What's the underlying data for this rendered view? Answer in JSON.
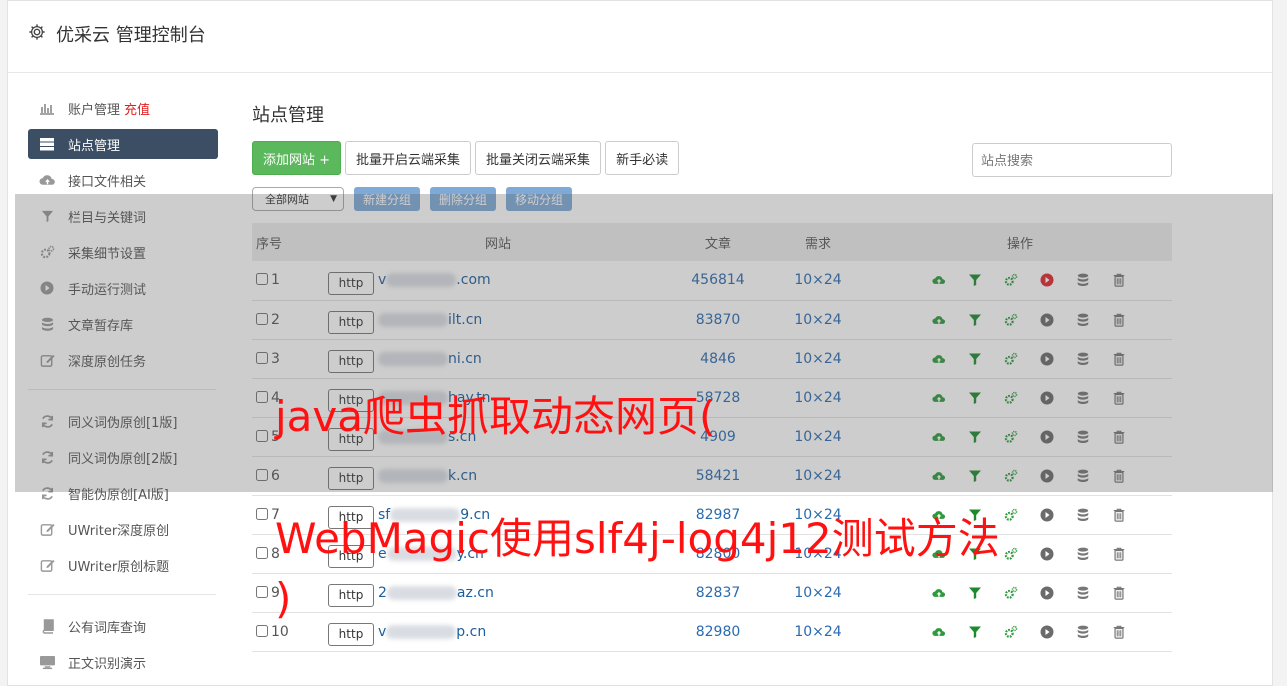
{
  "header": {
    "title": "优采云 管理控制台"
  },
  "sidebar": {
    "items": [
      {
        "label": "账户管理",
        "extra": "充值",
        "icon": "bar-chart-icon"
      },
      {
        "label": "站点管理",
        "icon": "server-icon"
      },
      {
        "label": "接口文件相关",
        "icon": "cloud-upload-icon"
      },
      {
        "label": "栏目与关键词",
        "icon": "filter-icon"
      },
      {
        "label": "采集细节设置",
        "icon": "gears-icon"
      },
      {
        "label": "手动运行测试",
        "icon": "play-icon"
      },
      {
        "label": "文章暂存库",
        "icon": "database-icon"
      },
      {
        "label": "深度原创任务",
        "icon": "edit-icon"
      }
    ],
    "items2": [
      {
        "label": "同义词伪原创[1版]",
        "icon": "refresh-icon"
      },
      {
        "label": "同义词伪原创[2版]",
        "icon": "refresh-icon"
      },
      {
        "label": "智能伪原创[AI版]",
        "icon": "refresh-icon"
      },
      {
        "label": "UWriter深度原创",
        "icon": "edit-icon"
      },
      {
        "label": "UWriter原创标题",
        "icon": "edit-icon"
      }
    ],
    "items3": [
      {
        "label": "公有词库查询",
        "icon": "book-icon"
      },
      {
        "label": "正文识别演示",
        "icon": "monitor-icon"
      }
    ]
  },
  "main": {
    "title": "站点管理",
    "buttons": {
      "add": "添加网站 +",
      "batch_on": "批量开启云端采集",
      "batch_off": "批量关闭云端采集",
      "guide": "新手必读"
    },
    "search_placeholder": "站点搜索",
    "group_select": "全部网站",
    "group_buttons": {
      "new": "新建分组",
      "delete": "删除分组",
      "move": "移动分组"
    },
    "table": {
      "headers": {
        "num": "序号",
        "site": "网站",
        "articles": "文章",
        "demand": "需求",
        "ops": "操作"
      },
      "rows": [
        {
          "num": "1",
          "proto": "http",
          "pre": "v",
          "post": ".com",
          "articles": "456814",
          "demand": "10×24",
          "active": true
        },
        {
          "num": "2",
          "proto": "http",
          "pre": "",
          "post": "ilt.cn",
          "articles": "83870",
          "demand": "10×24",
          "active": false
        },
        {
          "num": "3",
          "proto": "http",
          "pre": "",
          "post": "ni.cn",
          "articles": "4846",
          "demand": "10×24",
          "active": false
        },
        {
          "num": "4",
          "proto": "http",
          "pre": "",
          "post": "hay.tn",
          "articles": "58728",
          "demand": "10×24",
          "active": false
        },
        {
          "num": "5",
          "proto": "http",
          "pre": "",
          "post": "s.cn",
          "articles": "4909",
          "demand": "10×24",
          "active": false
        },
        {
          "num": "6",
          "proto": "http",
          "pre": "",
          "post": "k.cn",
          "articles": "58421",
          "demand": "10×24",
          "active": false
        },
        {
          "num": "7",
          "proto": "http",
          "pre": "sf",
          "post": "9.cn",
          "articles": "82987",
          "demand": "10×24",
          "active": false
        },
        {
          "num": "8",
          "proto": "http",
          "pre": "e",
          "post": "y.cn",
          "articles": "82800",
          "demand": "10×24",
          "active": false
        },
        {
          "num": "9",
          "proto": "http",
          "pre": "2",
          "post": "az.cn",
          "articles": "82837",
          "demand": "10×24",
          "active": false
        },
        {
          "num": "10",
          "proto": "http",
          "pre": "v",
          "post": "p.cn",
          "articles": "82980",
          "demand": "10×24",
          "active": false
        }
      ]
    }
  },
  "overlay": {
    "line1": "java爬虫抓取动态网页(",
    "line2": "WebMagic使用slf4j-log4j12测试方法",
    "line3": ")"
  },
  "colors": {
    "overlay_text": "#ff1111",
    "sidebar_active": "#3b4e63",
    "add_button": "#5cb85c",
    "link": "#2a6bb0"
  }
}
